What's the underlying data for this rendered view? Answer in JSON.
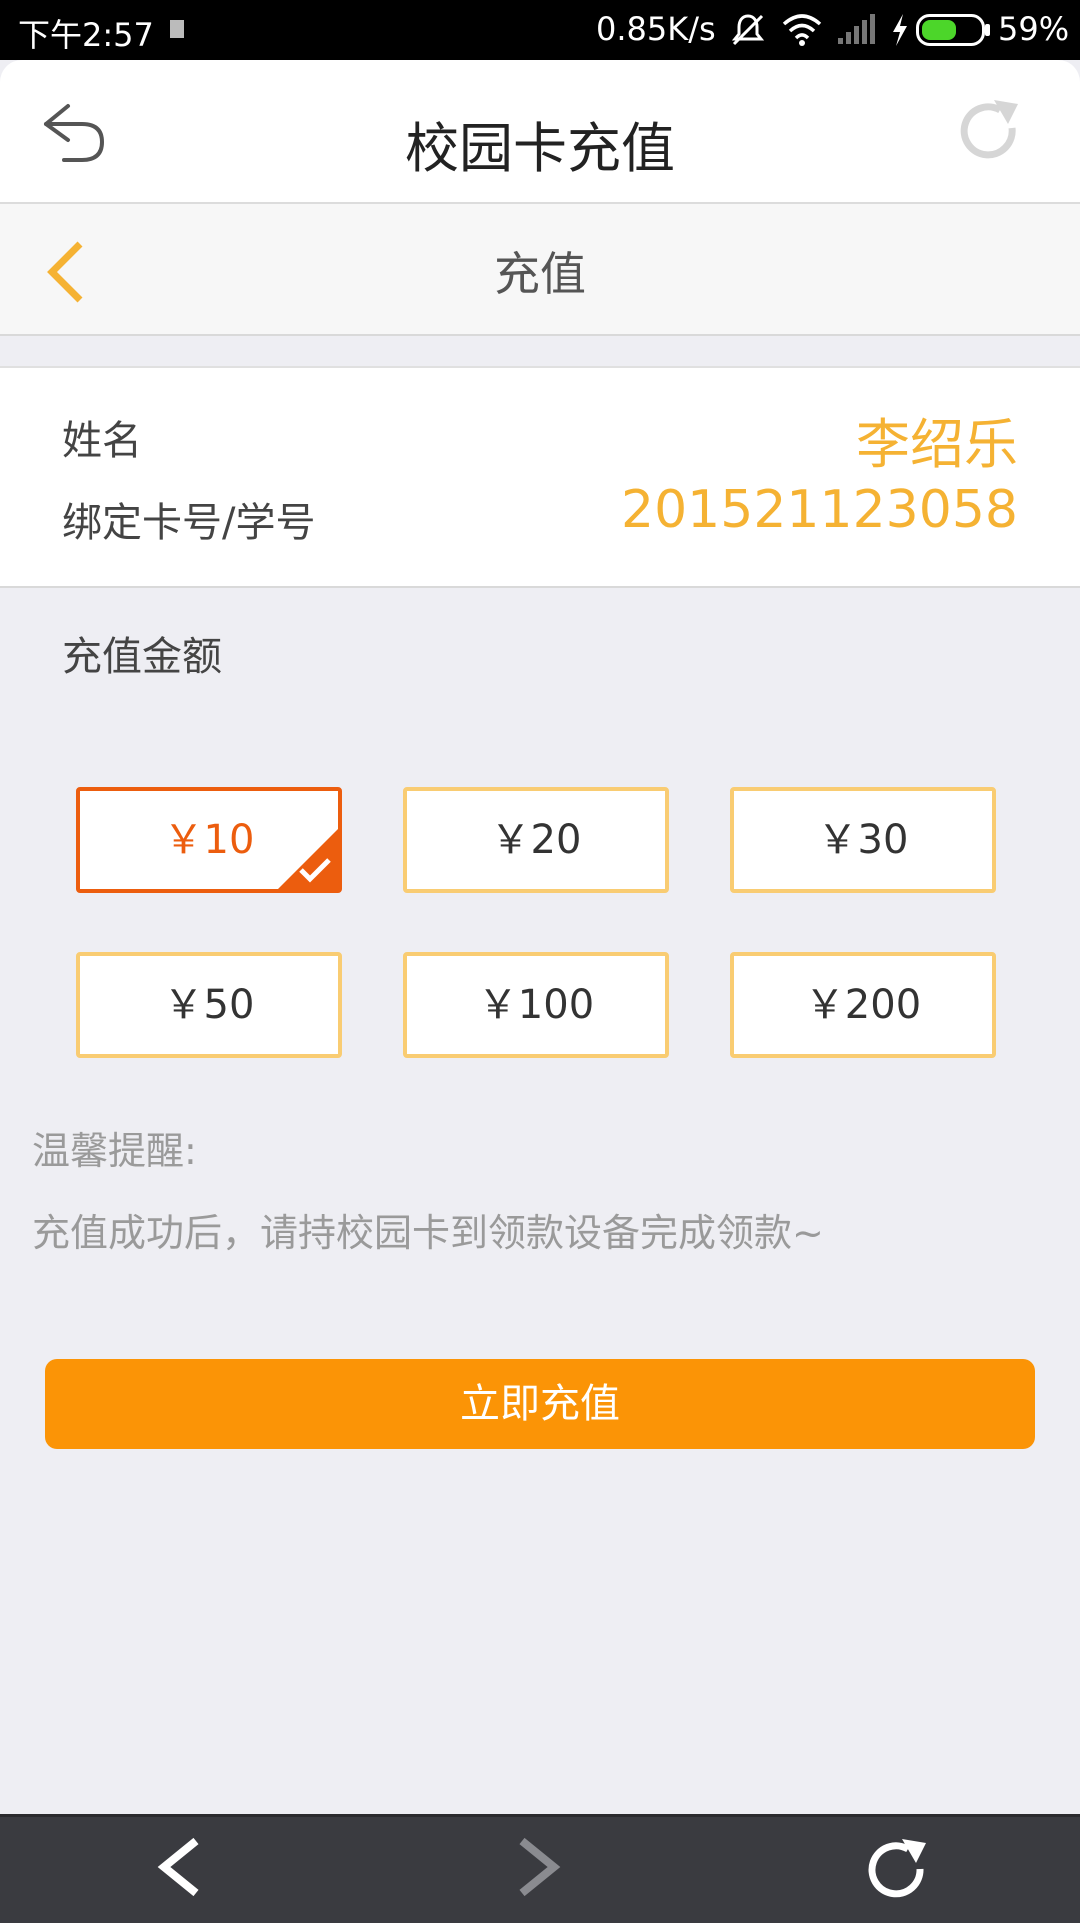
{
  "status_bar": {
    "time": "下午2:57",
    "network_speed": "0.85K/s",
    "battery_percent": "59%",
    "battery_level": 0.59,
    "icons": [
      "notification-icon",
      "mute-icon",
      "wifi-icon",
      "signal-icon",
      "charging-icon",
      "battery-icon"
    ]
  },
  "app_bar": {
    "title": "校园卡充值",
    "back_icon": "undo-arrow-icon",
    "refresh_icon": "refresh-icon"
  },
  "sub_header": {
    "title": "充值",
    "back_icon": "chevron-left-icon"
  },
  "info": {
    "name_label": "姓名",
    "name_value": "李绍乐",
    "card_label": "绑定卡号/学号",
    "card_value": "201521123058"
  },
  "amount": {
    "label": "充值金额",
    "options": [
      {
        "label": "￥10",
        "selected": true
      },
      {
        "label": "￥20",
        "selected": false
      },
      {
        "label": "￥30",
        "selected": false
      },
      {
        "label": "￥50",
        "selected": false
      },
      {
        "label": "￥100",
        "selected": false
      },
      {
        "label": "￥200",
        "selected": false
      }
    ]
  },
  "tip": {
    "title": "温馨提醒:",
    "text": "充值成功后，请持校园卡到领款设备完成领款~"
  },
  "submit_label": "立即充值",
  "bottom_nav": {
    "icons": [
      "nav-back-icon",
      "nav-forward-icon",
      "nav-reload-icon"
    ]
  },
  "colors": {
    "accent_orange": "#fb9406",
    "selected_orange": "#ec5d0e",
    "info_value": "#f5b233",
    "option_border": "#f9cc72"
  }
}
